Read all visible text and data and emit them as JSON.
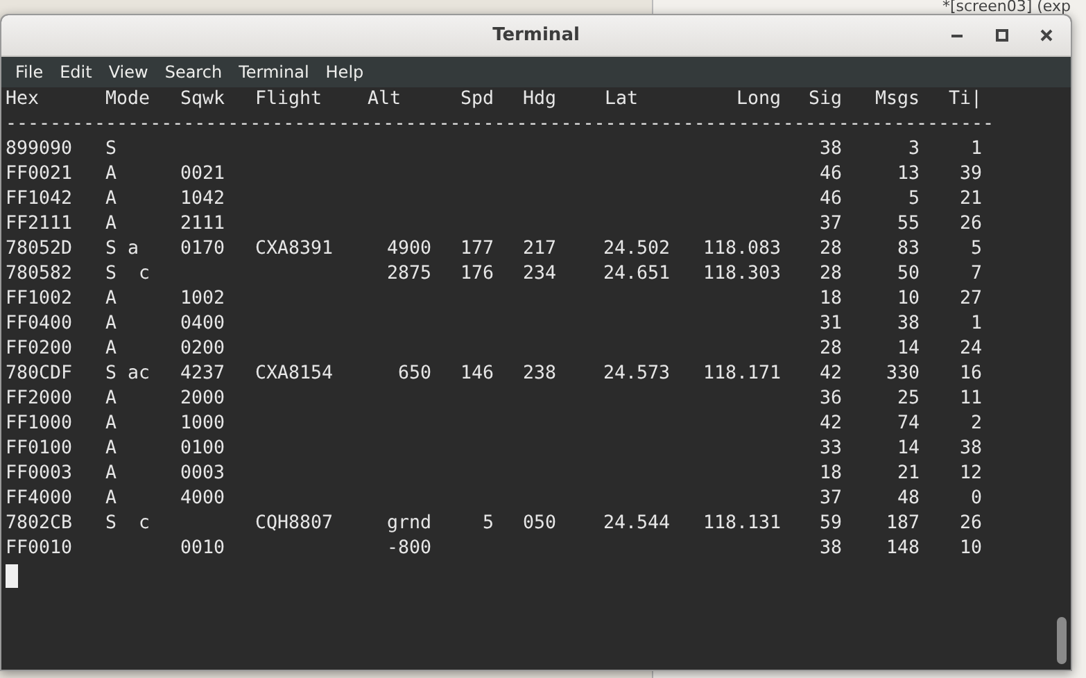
{
  "background_window": {
    "title": "*[screen03] (exp"
  },
  "window": {
    "title": "Terminal"
  },
  "menu": [
    "File",
    "Edit",
    "View",
    "Search",
    "Terminal",
    "Help"
  ],
  "table": {
    "columns": [
      "Hex",
      "Mode",
      "Sqwk",
      "Flight",
      "Alt",
      "Spd",
      "Hdg",
      "Lat",
      "Long",
      "Sig",
      "Msgs",
      "Ti|"
    ],
    "separator": "-----------------------------------------------------------------------------------------",
    "rows": [
      [
        "899090",
        "S",
        "",
        "",
        "",
        "",
        "",
        "",
        "",
        "38",
        "3",
        "1"
      ],
      [
        "FF0021",
        "A",
        "0021",
        "",
        "",
        "",
        "",
        "",
        "",
        "46",
        "13",
        "39"
      ],
      [
        "FF1042",
        "A",
        "1042",
        "",
        "",
        "",
        "",
        "",
        "",
        "46",
        "5",
        "21"
      ],
      [
        "FF2111",
        "A",
        "2111",
        "",
        "",
        "",
        "",
        "",
        "",
        "37",
        "55",
        "26"
      ],
      [
        "78052D",
        "S a",
        "0170",
        "CXA8391",
        "4900",
        "177",
        "217",
        "24.502",
        "118.083",
        "28",
        "83",
        "5"
      ],
      [
        "780582",
        "S  c",
        "",
        "",
        "2875",
        "176",
        "234",
        "24.651",
        "118.303",
        "28",
        "50",
        "7"
      ],
      [
        "FF1002",
        "A",
        "1002",
        "",
        "",
        "",
        "",
        "",
        "",
        "18",
        "10",
        "27"
      ],
      [
        "FF0400",
        "A",
        "0400",
        "",
        "",
        "",
        "",
        "",
        "",
        "31",
        "38",
        "1"
      ],
      [
        "FF0200",
        "A",
        "0200",
        "",
        "",
        "",
        "",
        "",
        "",
        "28",
        "14",
        "24"
      ],
      [
        "780CDF",
        "S ac",
        "4237",
        "CXA8154",
        "650",
        "146",
        "238",
        "24.573",
        "118.171",
        "42",
        "330",
        "16"
      ],
      [
        "FF2000",
        "A",
        "2000",
        "",
        "",
        "",
        "",
        "",
        "",
        "36",
        "25",
        "11"
      ],
      [
        "FF1000",
        "A",
        "1000",
        "",
        "",
        "",
        "",
        "",
        "",
        "42",
        "74",
        "2"
      ],
      [
        "FF0100",
        "A",
        "0100",
        "",
        "",
        "",
        "",
        "",
        "",
        "33",
        "14",
        "38"
      ],
      [
        "FF0003",
        "A",
        "0003",
        "",
        "",
        "",
        "",
        "",
        "",
        "18",
        "21",
        "12"
      ],
      [
        "FF4000",
        "A",
        "4000",
        "",
        "",
        "",
        "",
        "",
        "",
        "37",
        "48",
        "0"
      ],
      [
        "7802CB",
        "S  c",
        "",
        "CQH8807",
        "grnd",
        "5",
        "050",
        "24.544",
        "118.131",
        "59",
        "187",
        "26"
      ],
      [
        "FF0010",
        "",
        "0010",
        "",
        "-800",
        "",
        "",
        "",
        "",
        "38",
        "148",
        "10"
      ]
    ]
  }
}
